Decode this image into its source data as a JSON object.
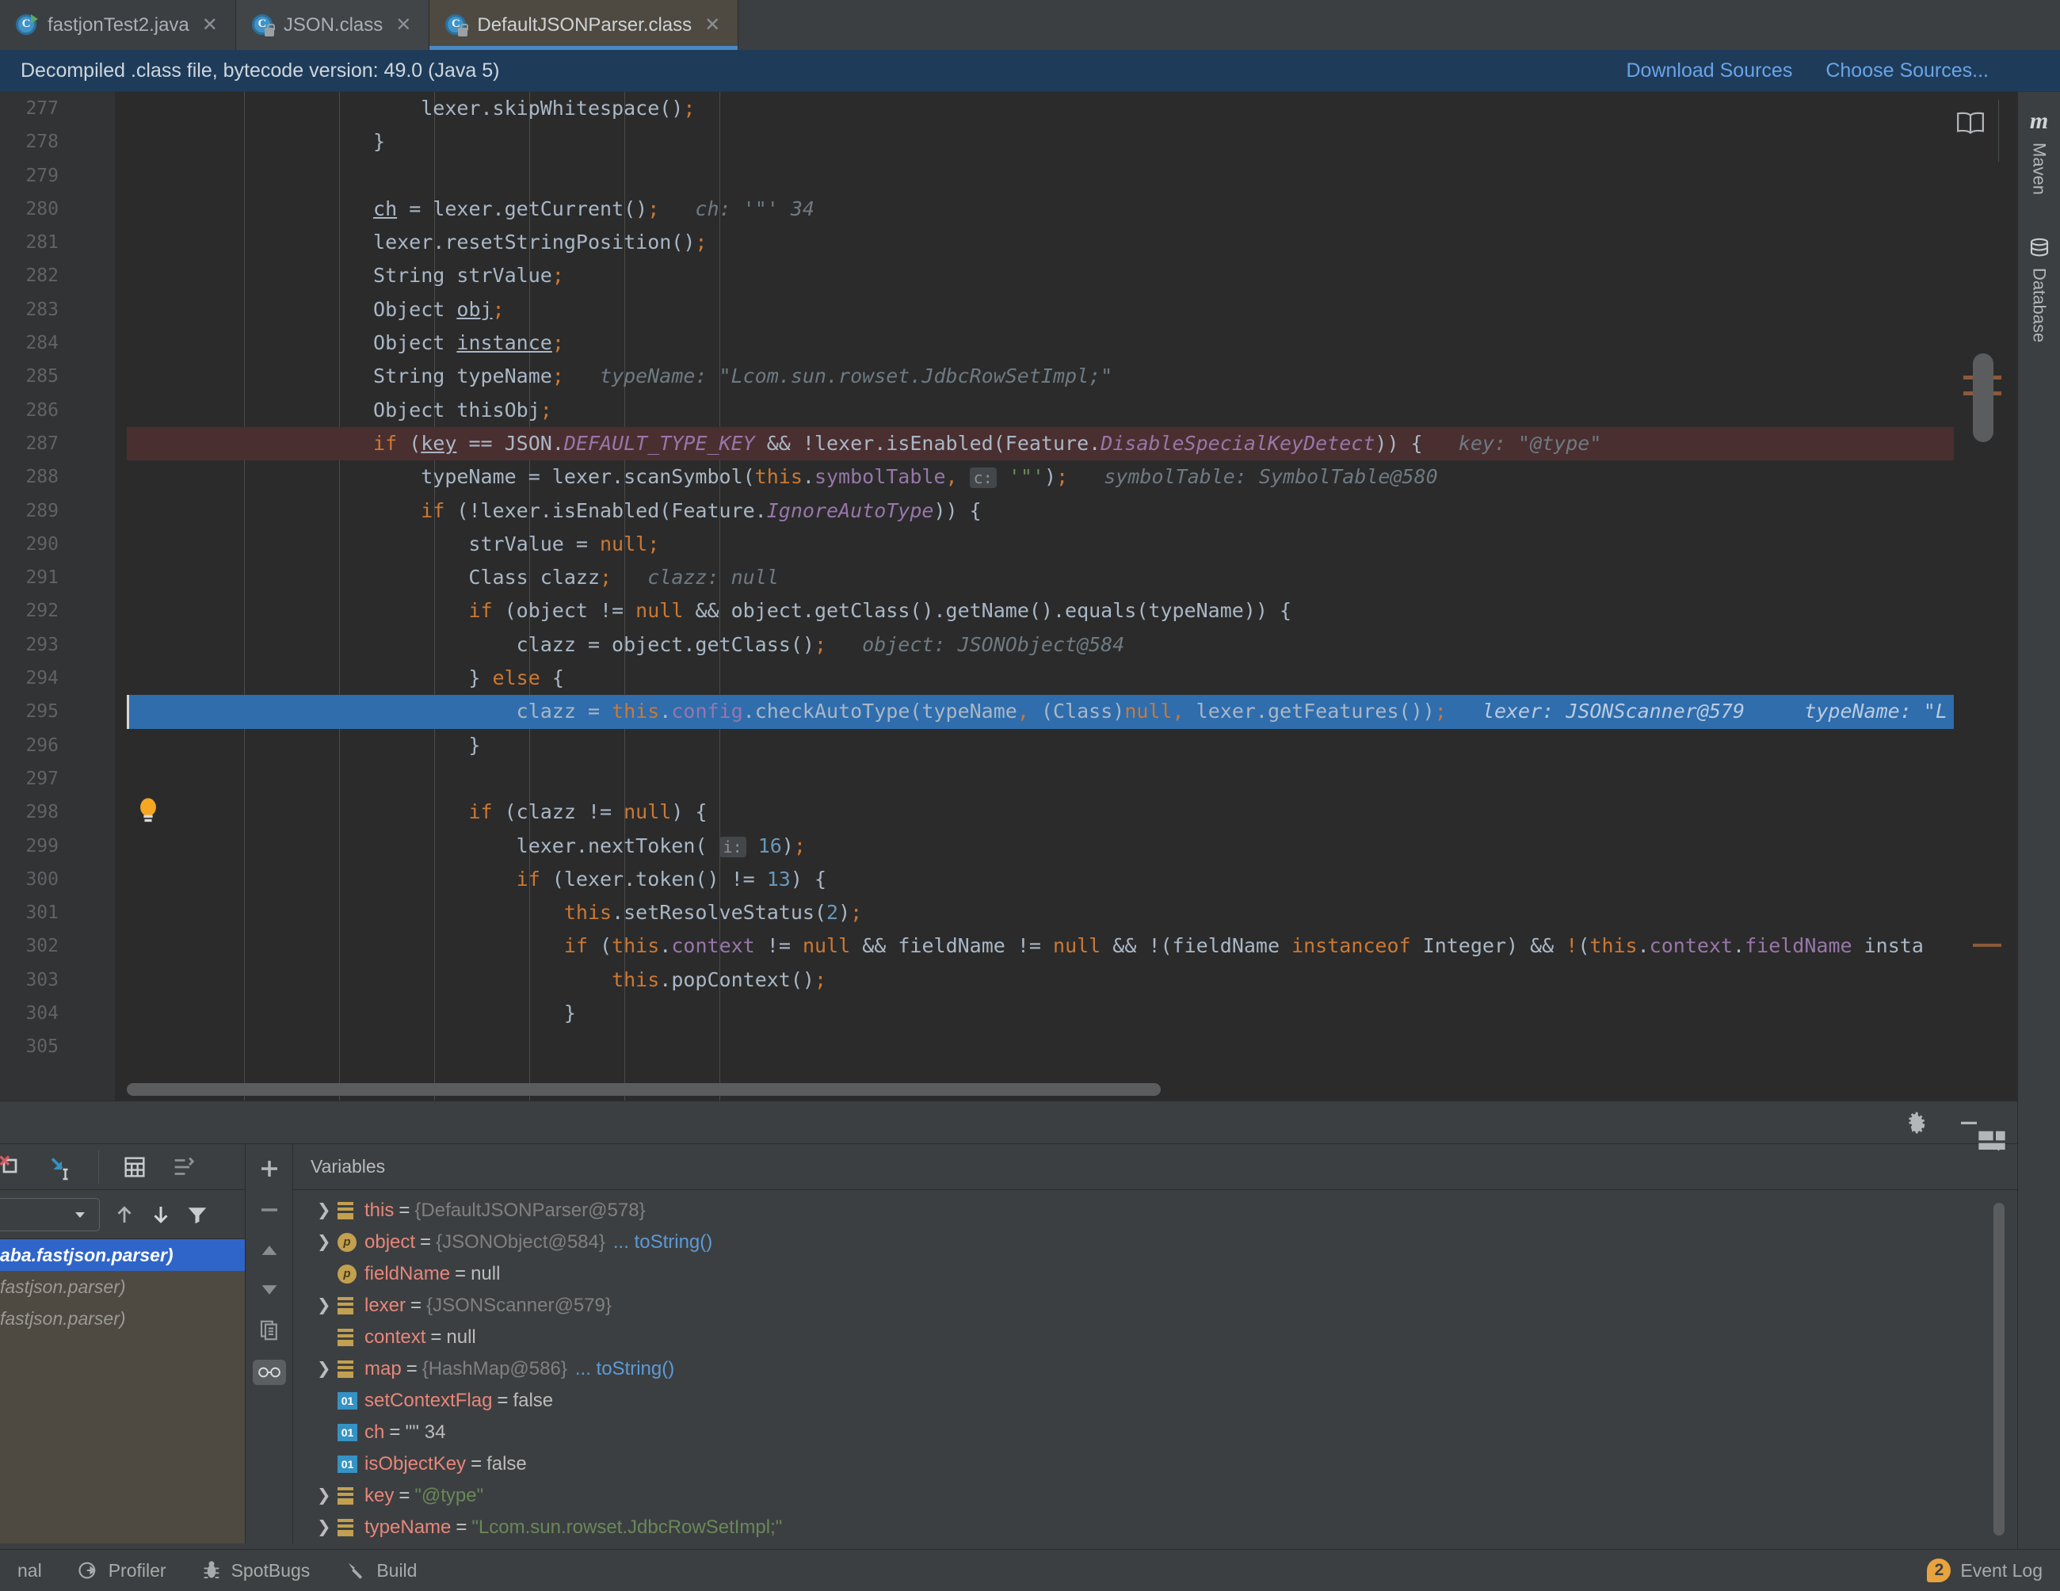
{
  "window": {
    "tabs": [
      {
        "label": "fastjonTest2.java",
        "icon": "java-class-run-icon",
        "state": "inactive"
      },
      {
        "label": "JSON.class",
        "icon": "java-class-locked-icon",
        "state": "inactive"
      },
      {
        "label": "DefaultJSONParser.class",
        "icon": "java-class-locked-icon",
        "state": "active"
      }
    ],
    "tab_close_glyph": "✕"
  },
  "notification": {
    "message": "Decompiled .class file, bytecode version: 49.0 (Java 5)",
    "actions": [
      {
        "label": "Download Sources",
        "name": "download-sources-link"
      },
      {
        "label": "Choose Sources...",
        "name": "choose-sources-link"
      }
    ]
  },
  "editor": {
    "first_line": 277,
    "breakpoint_lines": [
      287,
      295
    ],
    "highlighted_line": 287,
    "selected_line": 295,
    "lines": [
      {
        "n": 277,
        "fold": "plain"
      },
      {
        "n": 278,
        "fold": "end"
      },
      {
        "n": 279,
        "fold": ""
      },
      {
        "n": 280,
        "fold": ""
      },
      {
        "n": 281,
        "fold": ""
      },
      {
        "n": 282,
        "fold": ""
      },
      {
        "n": 283,
        "fold": ""
      },
      {
        "n": 284,
        "fold": ""
      },
      {
        "n": 285,
        "fold": ""
      },
      {
        "n": 286,
        "fold": ""
      },
      {
        "n": 287,
        "fold": "start"
      },
      {
        "n": 288,
        "fold": ""
      },
      {
        "n": 289,
        "fold": "start"
      },
      {
        "n": 290,
        "fold": ""
      },
      {
        "n": 291,
        "fold": ""
      },
      {
        "n": 292,
        "fold": "start"
      },
      {
        "n": 293,
        "fold": ""
      },
      {
        "n": 294,
        "fold": "end"
      },
      {
        "n": 295,
        "fold": ""
      },
      {
        "n": 296,
        "fold": "end"
      },
      {
        "n": 297,
        "fold": ""
      },
      {
        "n": 298,
        "fold": "start"
      },
      {
        "n": 299,
        "fold": ""
      },
      {
        "n": 300,
        "fold": "start"
      },
      {
        "n": 301,
        "fold": ""
      },
      {
        "n": 302,
        "fold": "start"
      },
      {
        "n": 303,
        "fold": ""
      },
      {
        "n": 304,
        "fold": "end"
      },
      {
        "n": 305,
        "fold": ""
      }
    ],
    "source_text": [
      "                        lexer.skipWhitespace();",
      "                    }",
      "",
      "                    ch = lexer.getCurrent();   ch: '\"' 34",
      "                    lexer.resetStringPosition();",
      "                    String strValue;",
      "                    Object obj;",
      "                    Object instance;",
      "                    String typeName;   typeName: \"Lcom.sun.rowset.JdbcRowSetImpl;\"",
      "                    Object thisObj;",
      "                    if (key == JSON.DEFAULT_TYPE_KEY && !lexer.isEnabled(Feature.DisableSpecialKeyDetect)) {   key: \"@type\"",
      "                        typeName = lexer.scanSymbol(this.symbolTable,  c: '\"');   symbolTable: SymbolTable@580",
      "                        if (!lexer.isEnabled(Feature.IgnoreAutoType)) {",
      "                            strValue = null;",
      "                            Class clazz;   clazz: null",
      "                            if (object != null && object.getClass().getName().equals(typeName)) {",
      "                                clazz = object.getClass();   object: JSONObject@584",
      "                            } else {",
      "                                clazz = this.config.checkAutoType(typeName, (Class)null, lexer.getFeatures());   lexer: JSONScanner@579     typeName: \"L",
      "                            }",
      "",
      "                            if (clazz != null) {",
      "                                lexer.nextToken( i: 16);",
      "                                if (lexer.token() != 13) {",
      "                                    this.setResolveStatus(2);",
      "                                    if (this.context != null && fieldName != null && !(fieldName instanceof Integer) && !(this.context.fieldName insta",
      "                                        this.popContext();",
      "                                    }",
      ""
    ],
    "right_gutter_icons": [
      {
        "name": "reader-mode-icon",
        "glyph": "book"
      }
    ],
    "intention_bulb": "intention-bulb-icon"
  },
  "right_tool_strip": {
    "items": [
      {
        "label": "Maven",
        "icon": "maven-icon"
      },
      {
        "label": "Database",
        "icon": "database-icon"
      }
    ]
  },
  "debugger": {
    "header_buttons": [
      {
        "name": "settings-gear-button",
        "icon": "gear-icon"
      },
      {
        "name": "hide-panel-button",
        "icon": "minimize-icon"
      }
    ],
    "layout_button": {
      "name": "layout-settings-button",
      "icon": "layout-icon"
    },
    "toolbar": [
      {
        "name": "mute-breakpoints-button",
        "icon": "mute-breakpoints-icon"
      },
      {
        "name": "step-into-button",
        "icon": "force-step-into-icon"
      },
      {
        "name": "evaluate-expression-button",
        "icon": "calculator-icon"
      },
      {
        "name": "show-values-inline-button",
        "icon": "inline-values-icon"
      }
    ],
    "frames": {
      "thread_selector_value": "",
      "nav_buttons": [
        {
          "name": "frames-up-button",
          "icon": "arrow-up-icon"
        },
        {
          "name": "frames-down-button",
          "icon": "arrow-down-icon"
        },
        {
          "name": "frames-filter-button",
          "icon": "filter-icon"
        }
      ],
      "items": [
        {
          "label": "aba.fastjson.parser)",
          "selected": true
        },
        {
          "label": "fastjson.parser)",
          "selected": false
        },
        {
          "label": "fastjson.parser)",
          "selected": false
        }
      ]
    },
    "side_tools": [
      {
        "name": "add-watch-button",
        "icon": "plus-icon"
      },
      {
        "name": "remove-watch-button",
        "icon": "minus-icon"
      },
      {
        "name": "move-watch-up-button",
        "icon": "triangle-up-icon"
      },
      {
        "name": "move-watch-down-button",
        "icon": "triangle-down-icon"
      },
      {
        "name": "copy-value-button",
        "icon": "copy-icon"
      },
      {
        "name": "inspect-button",
        "icon": "glasses-icon",
        "active": true
      }
    ],
    "variables_tab": "Variables",
    "variables": [
      {
        "expandable": true,
        "icon": "field-icon",
        "name": "this",
        "value": "{DefaultJSONParser@578}",
        "value_kind": "ref",
        "tostring": ""
      },
      {
        "expandable": true,
        "icon": "parameter-icon",
        "name": "object",
        "value": "{JSONObject@584}",
        "value_kind": "ref",
        "tostring": "... toString()"
      },
      {
        "expandable": false,
        "icon": "parameter-icon",
        "name": "fieldName",
        "value": "null",
        "value_kind": "plain",
        "tostring": ""
      },
      {
        "expandable": true,
        "icon": "field-icon",
        "name": "lexer",
        "value": "{JSONScanner@579}",
        "value_kind": "ref",
        "tostring": ""
      },
      {
        "expandable": false,
        "icon": "field-icon",
        "name": "context",
        "value": "null",
        "value_kind": "plain",
        "tostring": ""
      },
      {
        "expandable": true,
        "icon": "field-icon",
        "name": "map",
        "value": "{HashMap@586}",
        "value_kind": "ref",
        "tostring": "... toString()"
      },
      {
        "expandable": false,
        "icon": "primitive-icon",
        "name": "setContextFlag",
        "value": "false",
        "value_kind": "plain",
        "tostring": ""
      },
      {
        "expandable": false,
        "icon": "primitive-icon",
        "name": "ch",
        "value": "'\"' 34",
        "value_kind": "plain",
        "tostring": ""
      },
      {
        "expandable": false,
        "icon": "primitive-icon",
        "name": "isObjectKey",
        "value": "false",
        "value_kind": "plain",
        "tostring": ""
      },
      {
        "expandable": true,
        "icon": "field-icon",
        "name": "key",
        "value": "\"@type\"",
        "value_kind": "string",
        "tostring": ""
      },
      {
        "expandable": true,
        "icon": "field-icon",
        "name": "typeName",
        "value": "\"Lcom.sun.rowset.JdbcRowSetImpl;\"",
        "value_kind": "string",
        "tostring": ""
      }
    ]
  },
  "statusbar": {
    "left_items": [
      {
        "label": "nal",
        "icon": ""
      },
      {
        "label": "Profiler",
        "icon": "profiler-icon"
      },
      {
        "label": "SpotBugs",
        "icon": "bug-icon"
      },
      {
        "label": "Build",
        "icon": "hammer-icon"
      }
    ],
    "event_log": {
      "label": "Event Log",
      "count": "2"
    }
  },
  "colors": {
    "accent_blue": "#2f6dad",
    "selection_blue": "#2f65c8",
    "breakpoint_red": "#db5860",
    "notif_bg": "#1e3c5a",
    "editor_bg": "#2b2b2b",
    "panel_bg": "#3c3f41",
    "frames_bg": "#4e4a41",
    "string_green": "#6a8759",
    "keyword_orange": "#cc7832",
    "number_blue": "#6897bb",
    "static_purple": "#9876aa"
  }
}
